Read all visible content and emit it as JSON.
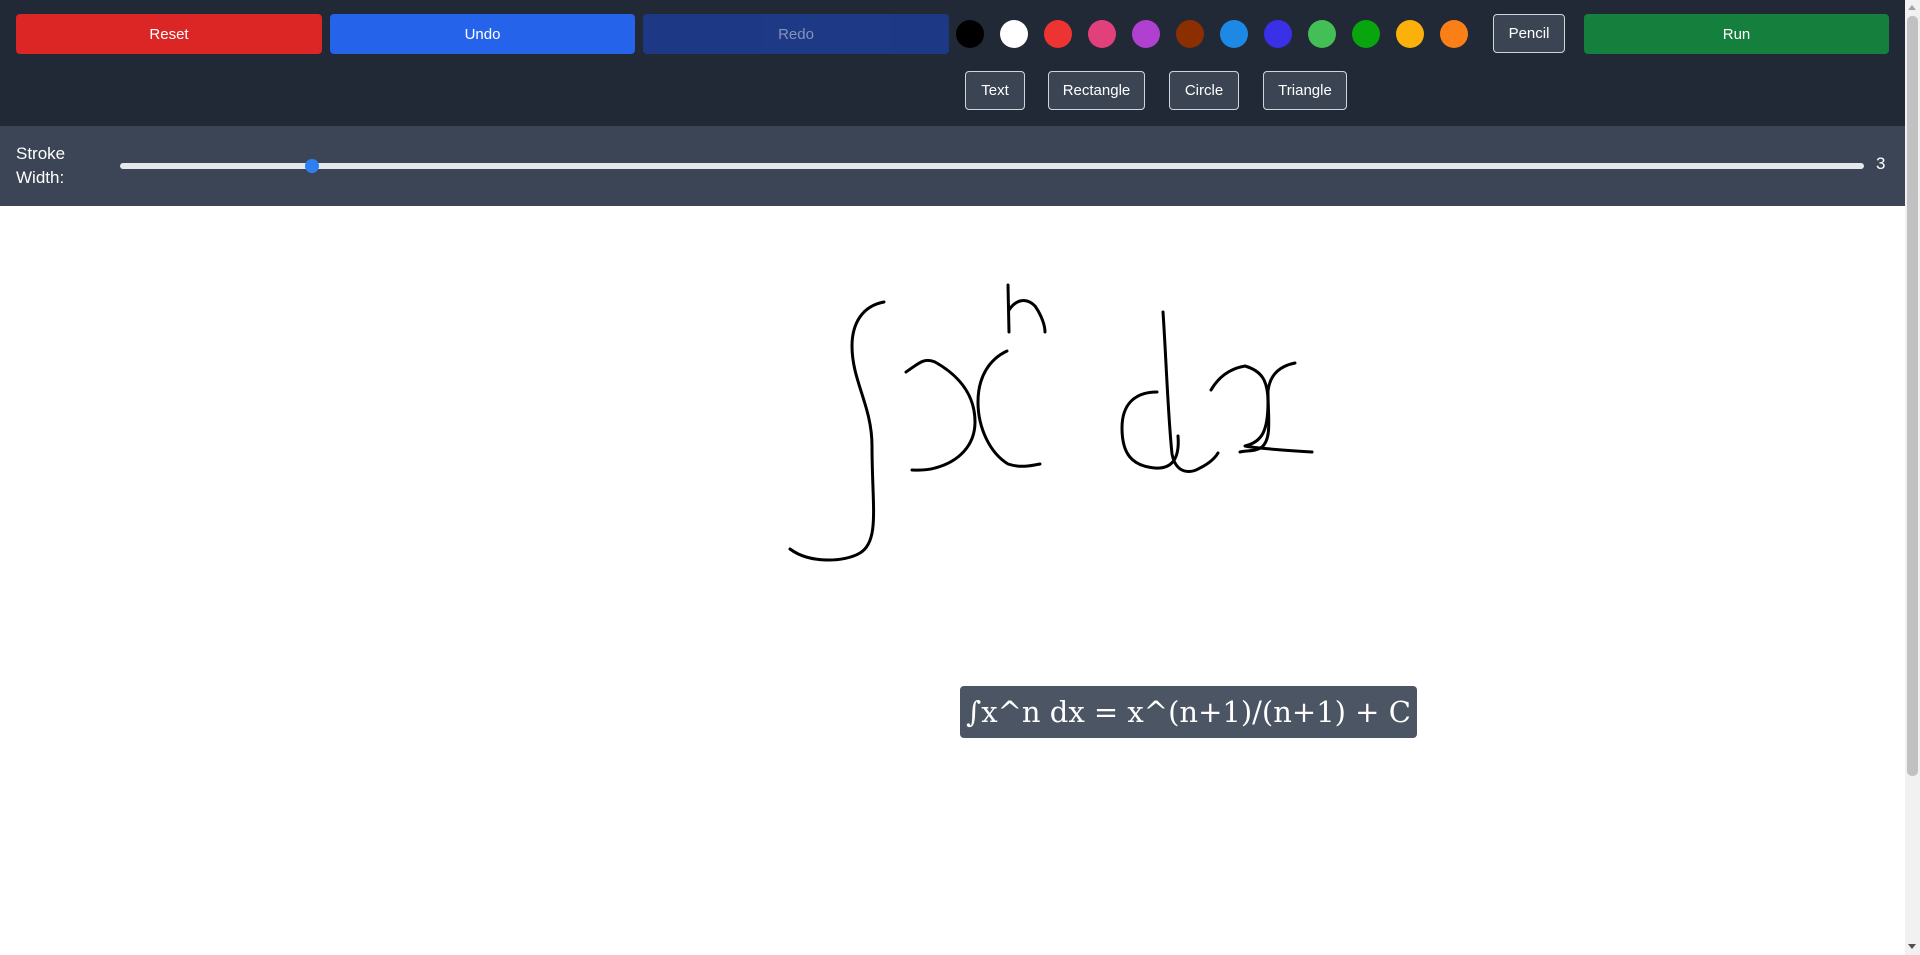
{
  "toolbar": {
    "reset_label": "Reset",
    "undo_label": "Undo",
    "redo_label": "Redo",
    "run_label": "Run",
    "pencil_label": "Pencil",
    "text_label": "Text",
    "rectangle_label": "Rectangle",
    "circle_label": "Circle",
    "triangle_label": "Triangle",
    "colors": [
      "#000000",
      "#ffffff",
      "#ee3333",
      "#e2407a",
      "#b040d0",
      "#8b2f00",
      "#1e88e5",
      "#3a30e8",
      "#43bf55",
      "#08a50e",
      "#fbb10a",
      "#fb7f17"
    ],
    "accent_colors": {
      "reset": "#dc2626",
      "undo": "#2563eb",
      "redo": "#1e3a8a",
      "run": "#15803d"
    }
  },
  "stroke": {
    "label": "Stroke Width:",
    "value": "3",
    "slider_fraction": 0.11
  },
  "canvas": {
    "result_text": "∫x^n dx = x^(n+1)/(n+1) + C",
    "ink_color": "#000000"
  }
}
